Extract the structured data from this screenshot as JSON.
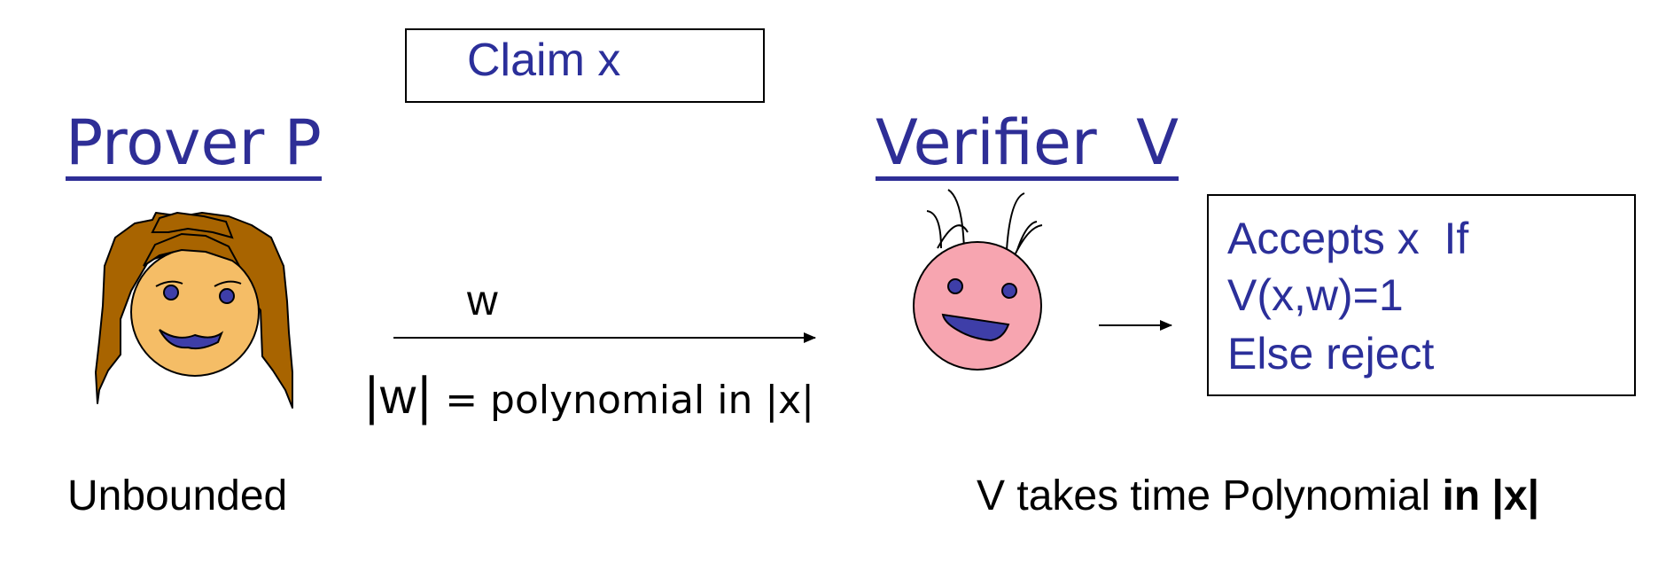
{
  "claim": {
    "label": "Claim x"
  },
  "prover": {
    "title": "Prover P",
    "caption": "Unbounded"
  },
  "verifier": {
    "title": "Verifier  V",
    "caption_plain": "V takes time Polynomial ",
    "caption_bold": "in |x|"
  },
  "message": {
    "label": "w",
    "length_bar_left": "|",
    "length_var": "w",
    "length_bar_right": "|",
    "length_rest": " = polynomial in |x|"
  },
  "decision": {
    "line1": "Accepts x  If",
    "line2": "V(x,w)=1",
    "line3": "Else reject"
  },
  "colors": {
    "title_blue": "#2e2e96",
    "text_blue": "#2b2f9a",
    "prover_hair": "#a86400",
    "prover_face": "#f5bd66",
    "verifier_face": "#f7a5b0",
    "eyes_mouth": "#3e3ea8"
  },
  "icons": {
    "prover": "girl-face-icon",
    "verifier": "alien-face-icon",
    "message_arrow": "right-arrow-icon",
    "decision_arrow": "right-arrow-icon"
  }
}
